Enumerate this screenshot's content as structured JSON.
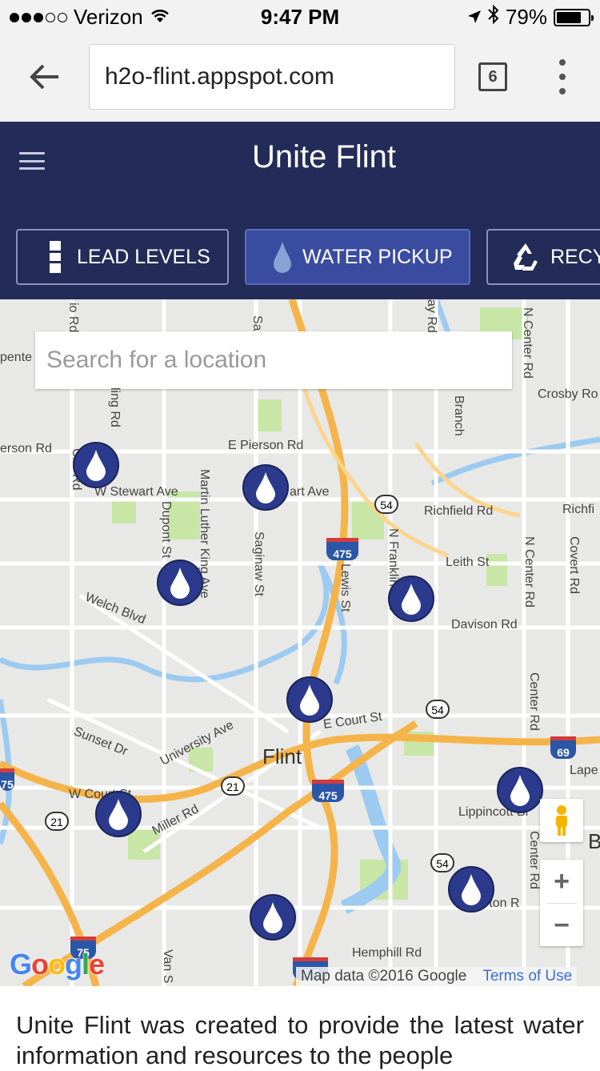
{
  "status_bar": {
    "carrier": "Verizon",
    "signal_bars_filled": 3,
    "signal_bars_total": 5,
    "time": "9:47 PM",
    "battery": "79%",
    "battery_level": 0.79
  },
  "browser": {
    "url": "h2o-flint.appspot.com",
    "tab_count": "6"
  },
  "header": {
    "title": "Unite Flint",
    "tabs": [
      {
        "label": "LEAD LEVELS",
        "icon": "thermometer-icon"
      },
      {
        "label": "WATER PICKUP",
        "icon": "water-drop-icon"
      },
      {
        "label": "RECY",
        "icon": "recycle-icon"
      }
    ]
  },
  "map": {
    "search_placeholder": "Search for a location",
    "city_label": "Flint",
    "street_labels": [
      "E Pierson Rd",
      "W Stewart Ave",
      "art Ave",
      "Richfield Rd",
      "Richfi",
      "Leith St",
      "Davison Rd",
      "Welch Blvd",
      "E Court St",
      "University Ave",
      "Sunset Dr",
      "W Court St",
      "Miller Rd",
      "Lippincott Bl",
      "Hemphill Rd",
      "Crosby Ro",
      "erson Rd",
      "pente",
      "Lape",
      "rton R",
      "B"
    ],
    "vertical_labels": [
      "Dupont St",
      "Martin Luther King Ave",
      "Saginaw St",
      "Lewis St",
      "N Franklin Ave",
      "N Center Rd",
      "N Center Rd",
      "Center Rd",
      "Center Rd",
      "Covert Rd",
      "Branch",
      "Van S",
      "ling Rd",
      "Clio Rd",
      "io Rd",
      "Sa",
      "ay Rd"
    ],
    "route_shields": [
      "54",
      "54",
      "54",
      "21",
      "21"
    ],
    "interstate_shields": [
      "475",
      "475",
      "69",
      "75",
      "475",
      "75"
    ],
    "attribution": "Map data ©2016 Google",
    "terms": "Terms of Use",
    "zoom_in": "+",
    "zoom_out": "−"
  },
  "intro_text": "Unite Flint was created to provide the latest water information and resources to the people",
  "colors": {
    "header_bg": "#232c58",
    "active_tab": "#3a4ca0",
    "marker": "#2b3a8c",
    "highway": "#f5b44a",
    "water": "#9ccaf0",
    "park": "#c8e6a6"
  }
}
